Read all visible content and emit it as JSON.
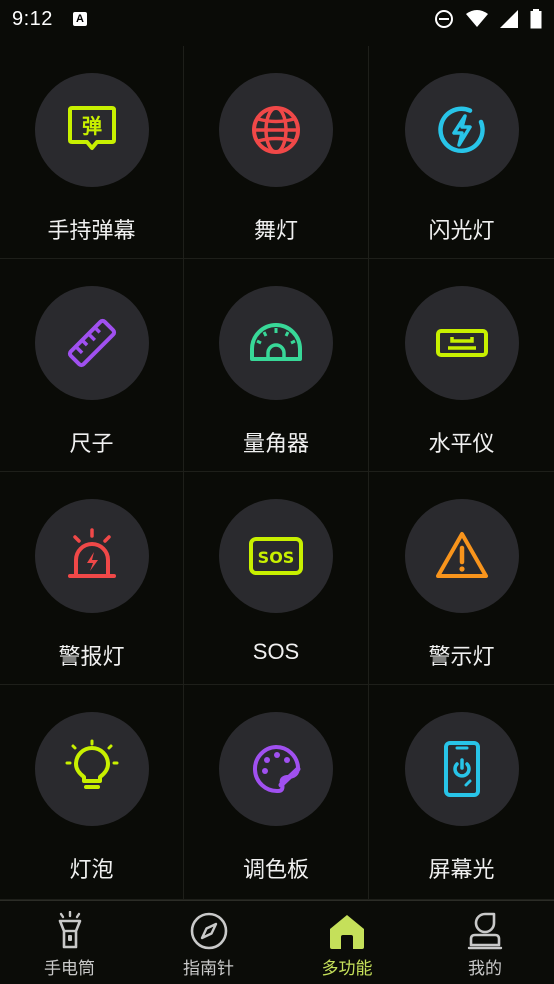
{
  "status_bar": {
    "time": "9:12",
    "notification_icon": "A"
  },
  "features": [
    {
      "label": "手持弹幕",
      "icon": "danmu-icon",
      "glyph": "弹",
      "color": "#c8f000"
    },
    {
      "label": "舞灯",
      "icon": "disco-ball-icon",
      "color": "#f04848"
    },
    {
      "label": "闪光灯",
      "icon": "flash-icon",
      "color": "#28c4e8"
    },
    {
      "label": "尺子",
      "icon": "ruler-icon",
      "color": "#a050f0"
    },
    {
      "label": "量角器",
      "icon": "protractor-icon",
      "color": "#38d898"
    },
    {
      "label": "水平仪",
      "icon": "level-icon",
      "color": "#c8f000"
    },
    {
      "label": "警报灯",
      "icon": "alarm-light-icon",
      "color": "#f04848"
    },
    {
      "label": "SOS",
      "icon": "sos-icon",
      "glyph": "SOS",
      "color": "#c8f000"
    },
    {
      "label": "警示灯",
      "icon": "warning-icon",
      "color": "#f8941c"
    },
    {
      "label": "灯泡",
      "icon": "bulb-icon",
      "color": "#c8f000"
    },
    {
      "label": "调色板",
      "icon": "palette-icon",
      "color": "#a050f0"
    },
    {
      "label": "屏幕光",
      "icon": "screen-light-icon",
      "color": "#28c4e8"
    }
  ],
  "bottom_nav": {
    "items": [
      {
        "label": "手电筒",
        "icon": "flashlight-icon"
      },
      {
        "label": "指南针",
        "icon": "compass-icon"
      },
      {
        "label": "多功能",
        "icon": "home-icon",
        "active": true
      },
      {
        "label": "我的",
        "icon": "profile-icon"
      }
    ],
    "active_color": "#c5e05a",
    "inactive_color": "#c9c9c9"
  }
}
